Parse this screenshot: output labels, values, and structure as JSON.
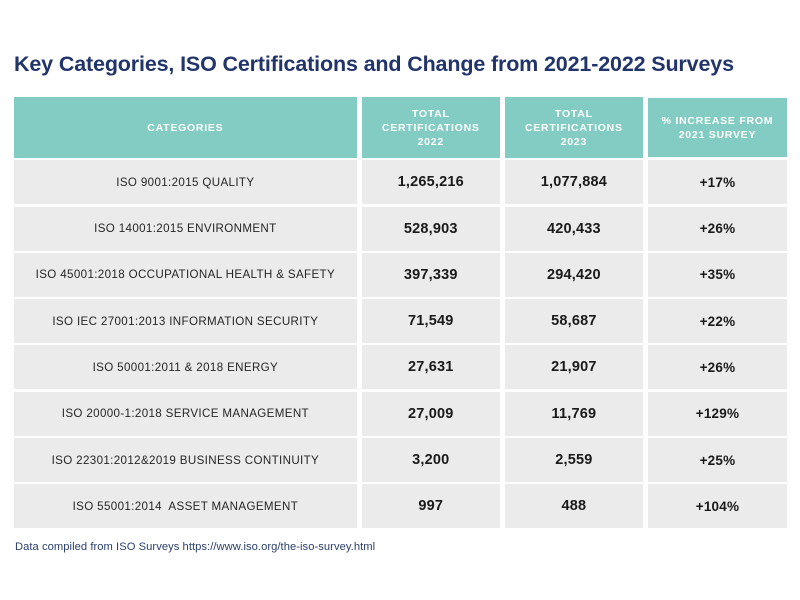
{
  "title": "Key Categories, ISO Certifications and Change from 2021-2022 Surveys",
  "source_note": "Data compiled from ISO Surveys https://www.iso.org/the-iso-survey.html",
  "theme": {
    "header_teal": "#83CCC4",
    "row_gray": "#EBEBEB",
    "title_navy": "#22356B",
    "text_dark": "#1a1a1a",
    "page_background": "#ffffff"
  },
  "table": {
    "columns": [
      {
        "key": "category",
        "label_lines": [
          "CATEGORIES"
        ]
      },
      {
        "key": "total_2022",
        "label_lines": [
          "TOTAL",
          "CERTIFICATIONS",
          "2022"
        ]
      },
      {
        "key": "total_2023",
        "label_lines": [
          "TOTAL",
          "CERTIFICATIONS",
          "2023"
        ]
      },
      {
        "key": "pct_increase",
        "label_lines": [
          "% INCREASE FROM",
          "2021 SURVEY"
        ]
      }
    ],
    "header": {
      "c1": "CATEGORIES",
      "c2_l1": "TOTAL",
      "c2_l2": "CERTIFICATIONS",
      "c2_l3": "2022",
      "c3_l1": "TOTAL",
      "c3_l2": "CERTIFICATIONS",
      "c3_l3": "2023",
      "c4_l1": "% INCREASE FROM",
      "c4_l2": "2021 SURVEY"
    },
    "rows": [
      {
        "category": "ISO 9001:2015 QUALITY",
        "total_2022": "1,265,216",
        "total_2023": "1,077,884",
        "pct_increase": "+17%"
      },
      {
        "category": "ISO 14001:2015 ENVIRONMENT",
        "total_2022": "528,903",
        "total_2023": "420,433",
        "pct_increase": "+26%"
      },
      {
        "category": "ISO 45001:2018 OCCUPATIONAL HEALTH & SAFETY",
        "total_2022": "397,339",
        "total_2023": "294,420",
        "pct_increase": "+35%"
      },
      {
        "category": "ISO IEC 27001:2013 INFORMATION SECURITY",
        "total_2022": "71,549",
        "total_2023": "58,687",
        "pct_increase": "+22%"
      },
      {
        "category": "ISO 50001:2011 & 2018 ENERGY",
        "total_2022": "27,631",
        "total_2023": "21,907",
        "pct_increase": "+26%"
      },
      {
        "category": "ISO 20000-1:2018 SERVICE MANAGEMENT",
        "total_2022": "27,009",
        "total_2023": "11,769",
        "pct_increase": "+129%"
      },
      {
        "category": "ISO 22301:2012&2019 BUSINESS CONTINUITY",
        "total_2022": "3,200",
        "total_2023": "2,559",
        "pct_increase": "+25%"
      },
      {
        "category": "ISO 55001:2014  ASSET MANAGEMENT",
        "total_2022": "997",
        "total_2023": "488",
        "pct_increase": "+104%"
      }
    ]
  },
  "chart_data": {
    "type": "table",
    "title": "Key Categories, ISO Certifications and Change from 2021-2022 Surveys",
    "columns": [
      "CATEGORIES",
      "TOTAL CERTIFICATIONS 2022",
      "TOTAL CERTIFICATIONS 2023",
      "% INCREASE FROM 2021 SURVEY"
    ],
    "categories": [
      "ISO 9001:2015 QUALITY",
      "ISO 14001:2015 ENVIRONMENT",
      "ISO 45001:2018 OCCUPATIONAL HEALTH & SAFETY",
      "ISO IEC 27001:2013 INFORMATION SECURITY",
      "ISO 50001:2011 & 2018 ENERGY",
      "ISO 20000-1:2018 SERVICE MANAGEMENT",
      "ISO 22301:2012&2019 BUSINESS CONTINUITY",
      "ISO 55001:2014  ASSET MANAGEMENT"
    ],
    "series": [
      {
        "name": "TOTAL CERTIFICATIONS 2022",
        "values": [
          1265216,
          528903,
          397339,
          71549,
          27631,
          27009,
          3200,
          997
        ]
      },
      {
        "name": "TOTAL CERTIFICATIONS 2023",
        "values": [
          1077884,
          420433,
          294420,
          58687,
          21907,
          11769,
          2559,
          488
        ]
      },
      {
        "name": "% INCREASE FROM 2021 SURVEY",
        "values": [
          17,
          26,
          35,
          22,
          26,
          129,
          25,
          104
        ]
      }
    ],
    "annotations": [
      "Data compiled from ISO Surveys https://www.iso.org/the-iso-survey.html"
    ]
  }
}
